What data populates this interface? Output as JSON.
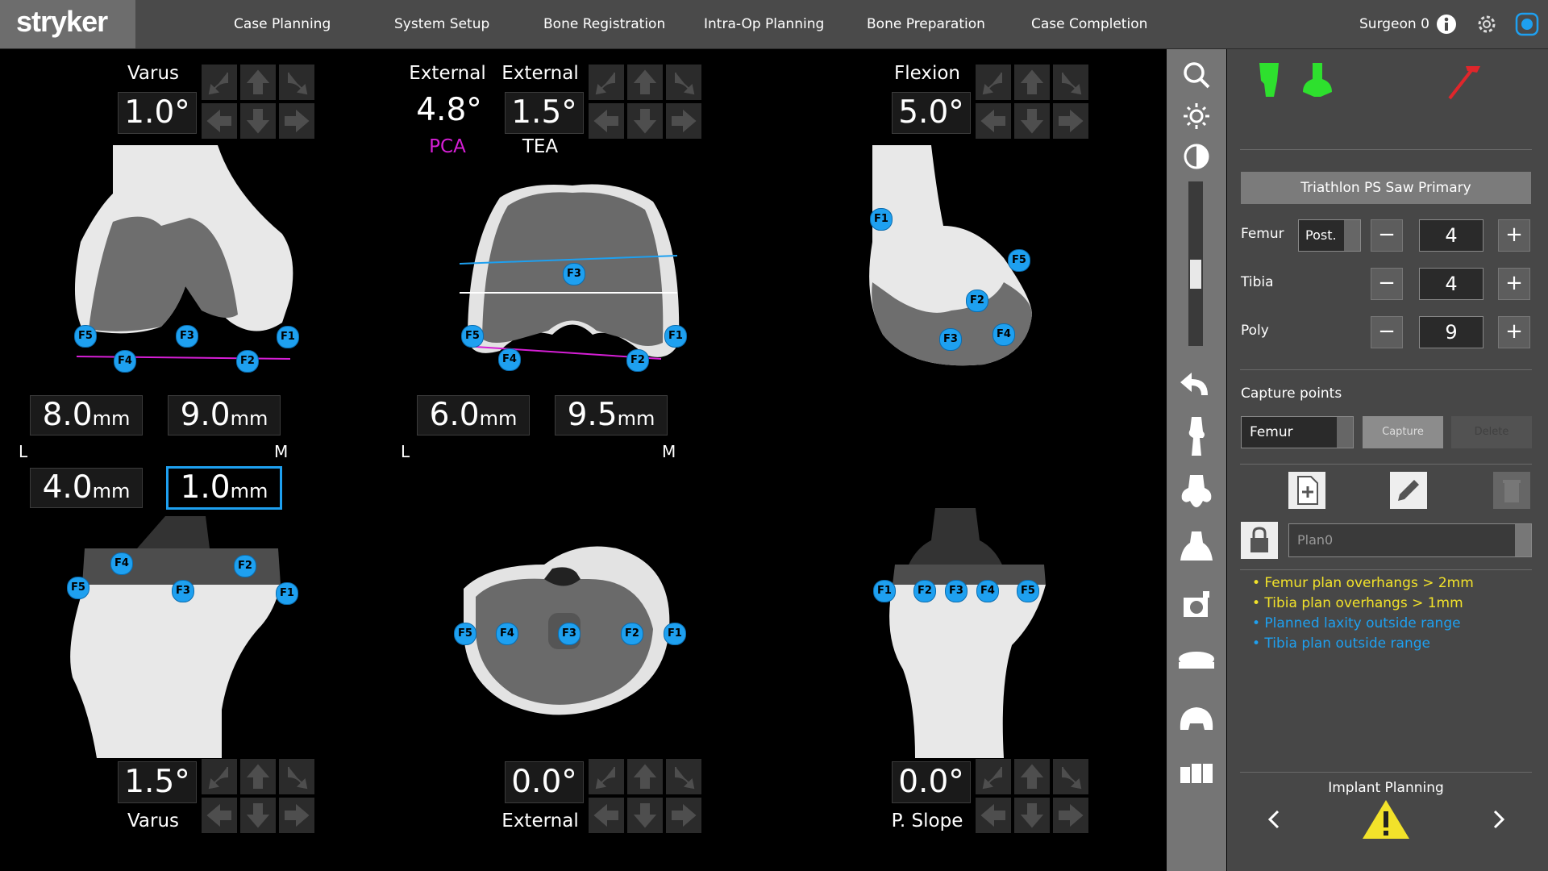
{
  "brand": "stryker",
  "nav": {
    "items": [
      "Case Planning",
      "System Setup",
      "Bone Registration",
      "Intra-Op Planning",
      "Bone Preparation",
      "Case Completion"
    ],
    "user": "Surgeon 0"
  },
  "femur_coronal": {
    "angle_label": "Varus",
    "angle_value": "1.0°",
    "left_res": "8.0",
    "right_res": "9.0",
    "unit": "mm",
    "side_left": "L",
    "side_right": "M",
    "points": [
      "F5",
      "F4",
      "F3",
      "F2",
      "F1"
    ]
  },
  "femur_axial": {
    "label1": "External",
    "value1": "4.8°",
    "ref1": "PCA",
    "label2": "External",
    "value2": "1.5°",
    "ref2": "TEA",
    "left_res": "6.0",
    "right_res": "9.5",
    "unit": "mm",
    "side_left": "L",
    "side_right": "M",
    "points": [
      "F5",
      "F4",
      "F3",
      "F2",
      "F1"
    ]
  },
  "femur_sagittal": {
    "angle_label": "Flexion",
    "angle_value": "5.0°",
    "points": [
      "F1",
      "F5",
      "F2",
      "F3",
      "F4"
    ]
  },
  "tibia_coronal": {
    "left_res": "4.0",
    "right_res": "1.0",
    "unit": "mm",
    "angle_value": "1.5°",
    "angle_label": "Varus",
    "points": [
      "F4",
      "F2",
      "F5",
      "F3",
      "F1"
    ]
  },
  "tibia_axial": {
    "angle_value": "0.0°",
    "angle_label": "External",
    "points": [
      "F5",
      "F4",
      "F3",
      "F2",
      "F1"
    ]
  },
  "tibia_sagittal": {
    "angle_value": "0.0°",
    "angle_label": "P. Slope",
    "points": [
      "F1",
      "F2",
      "F3",
      "F4",
      "F5"
    ]
  },
  "toolbar": {
    "icons": [
      "magnifier-icon",
      "brightness-icon",
      "contrast-icon",
      "undo-icon",
      "knee-joint-icon",
      "femur-implant-icon",
      "tibia-implant-icon",
      "probe-icon",
      "poly-insert-icon",
      "implant-3d-icon",
      "layout-icon"
    ],
    "brightness_level": 0.35
  },
  "panel": {
    "implant_system": "Triathlon PS Saw Primary",
    "femur_label": "Femur",
    "femur_type": "Post.",
    "femur_size": "4",
    "tibia_label": "Tibia",
    "tibia_size": "4",
    "poly_label": "Poly",
    "poly_size": "9",
    "capture_title": "Capture points",
    "capture_bone": "Femur",
    "capture_button": "Capture",
    "delete_button": "Delete",
    "plan_name": "Plan0",
    "warnings": [
      {
        "text": "Femur plan overhangs > 2mm",
        "color": "#f2e22a"
      },
      {
        "text": "Tibia plan overhangs > 1mm",
        "color": "#f2e22a"
      },
      {
        "text": "Planned laxity outside range",
        "color": "#1ea0f0"
      },
      {
        "text": "Tibia plan outside range",
        "color": "#1ea0f0"
      }
    ],
    "footer_title": "Implant Planning"
  },
  "colors": {
    "accent_blue": "#1ea0f0",
    "pink": "#d61fd6",
    "implant_green": "#2ee02e",
    "probe_red": "#e0262b",
    "warning_yellow": "#f2e22a"
  }
}
